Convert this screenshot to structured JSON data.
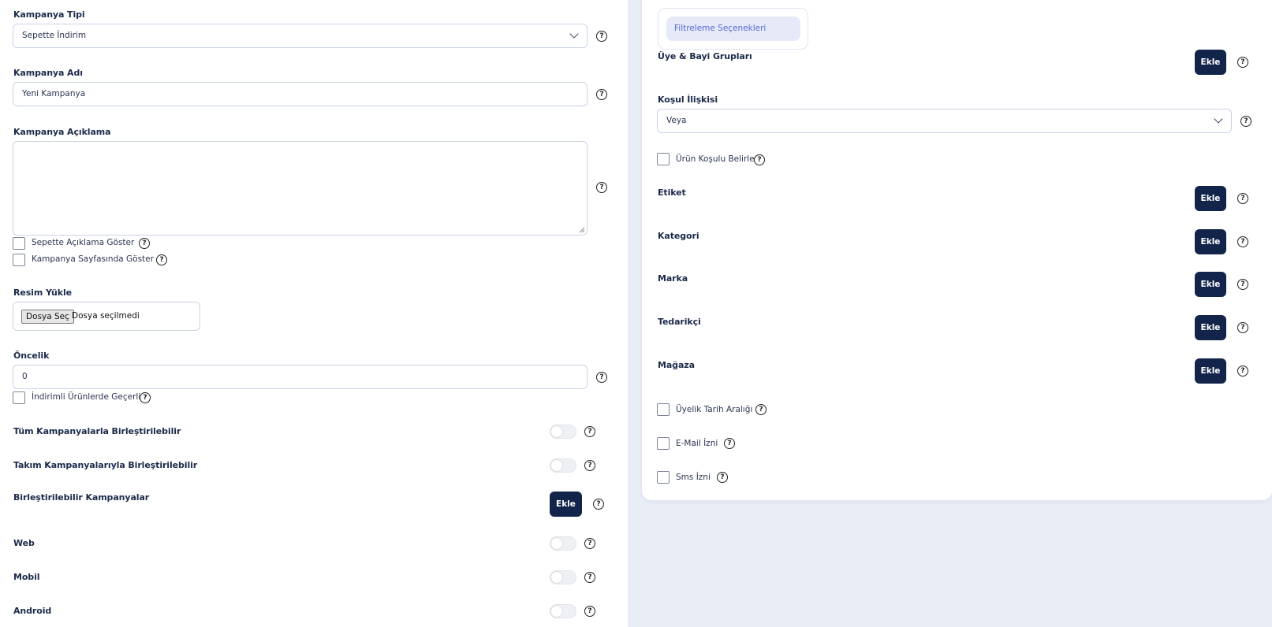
{
  "left": {
    "campaign_type": {
      "label": "Kampanya Tipi",
      "value": "Sepette İndirim"
    },
    "campaign_name": {
      "label": "Kampanya Adı",
      "value": "Yeni Kampanya"
    },
    "campaign_description": {
      "label": "Kampanya Açıklama",
      "value": ""
    },
    "show_description_in_cart": "Sepette Açıklama Göster",
    "show_on_campaign_page": "Kampanya Sayfasında Göster",
    "image_upload": {
      "label": "Resim Yükle",
      "button": "Dosya Seç",
      "status": "Dosya seçilmedi"
    },
    "priority": {
      "label": "Öncelik",
      "value": "0"
    },
    "valid_on_discounted": "İndirimli Ürünlerde Geçerli",
    "combinable_all": "Tüm Kampanyalarla Birleştirilebilir",
    "combinable_team": "Takım Kampanyalarıyla Birleştirilebilir",
    "combinable_campaigns": {
      "label": "Birleştirilebilir Kampanyalar",
      "button": "Ekle"
    },
    "web": "Web",
    "mobile": "Mobil",
    "android": "Android"
  },
  "right": {
    "tab": "Filtreleme Seçenekleri",
    "member_groups": {
      "label": "Üye & Bayi Grupları",
      "button": "Ekle"
    },
    "condition_relation": {
      "label": "Koşul İlişkisi",
      "value": "Veya"
    },
    "product_condition": "Ürün Koşulu Belirle",
    "tag": {
      "label": "Etiket",
      "button": "Ekle"
    },
    "category": {
      "label": "Kategori",
      "button": "Ekle"
    },
    "brand": {
      "label": "Marka",
      "button": "Ekle"
    },
    "supplier": {
      "label": "Tedarikçi",
      "button": "Ekle"
    },
    "store": {
      "label": "Mağaza",
      "button": "Ekle"
    },
    "membership_date_range": "Üyelik Tarih Aralığı",
    "email_permission": "E-Mail İzni",
    "sms_permission": "Sms İzni"
  },
  "help_symbol": "?",
  "colors": {
    "primary_button": "#13244a",
    "accent_tab_text": "#5867d8",
    "accent_tab_bg": "#e6eaf8",
    "page_bg": "#e9edf5"
  }
}
